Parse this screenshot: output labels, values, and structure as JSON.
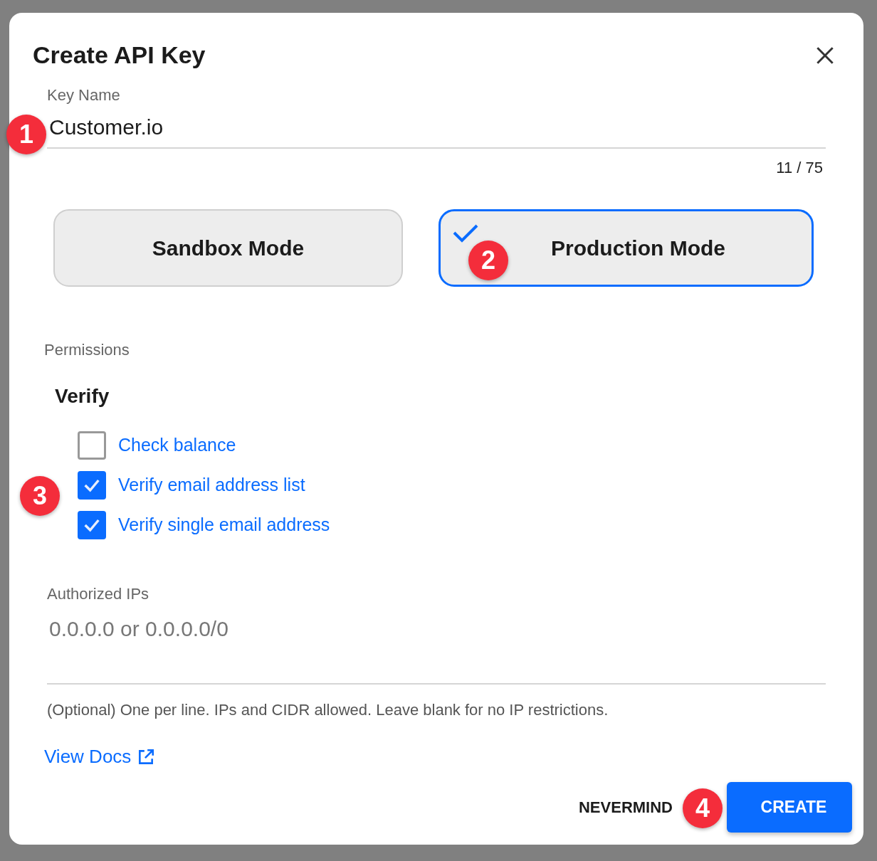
{
  "dialog": {
    "title": "Create API Key"
  },
  "key_name": {
    "label": "Key Name",
    "value": "Customer.io",
    "counter": "11 / 75"
  },
  "modes": [
    {
      "label": "Sandbox Mode",
      "selected": false
    },
    {
      "label": "Production Mode",
      "selected": true
    }
  ],
  "permissions": {
    "label": "Permissions",
    "group": "Verify",
    "items": [
      {
        "label": "Check balance",
        "checked": false
      },
      {
        "label": "Verify email address list",
        "checked": true
      },
      {
        "label": "Verify single email address",
        "checked": true
      }
    ]
  },
  "authorized_ips": {
    "label": "Authorized IPs",
    "placeholder": "0.0.0.0 or 0.0.0.0/0",
    "helper": "(Optional) One per line. IPs and CIDR allowed. Leave blank for no IP restrictions."
  },
  "docs_link": "View Docs",
  "buttons": [
    {
      "label": "NEVERMIND",
      "kind": "text"
    },
    {
      "label": "CREATE",
      "kind": "primary"
    }
  ],
  "annotations": [
    "1",
    "2",
    "3",
    "4"
  ]
}
